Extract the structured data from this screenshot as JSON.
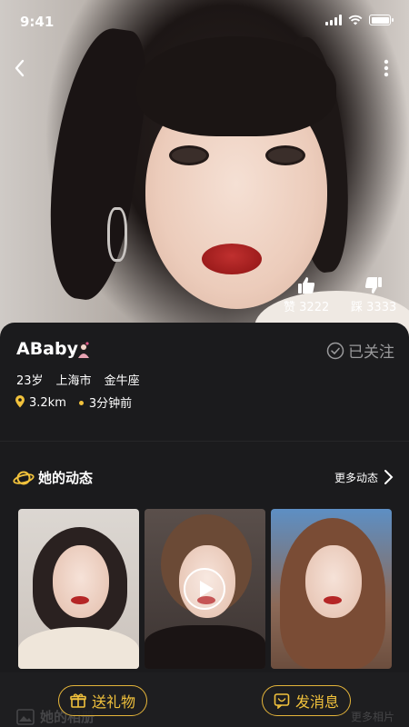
{
  "status_bar": {
    "time": "9:41"
  },
  "hero": {
    "like_label": "赞",
    "like_count": "3222",
    "dislike_label": "踩",
    "dislike_count": "3333"
  },
  "profile": {
    "name": "ABaby",
    "follow_label": "已关注",
    "age": "23岁",
    "city": "上海市",
    "zodiac": "金牛座",
    "distance": "3.2km",
    "last_active": "3分钟前"
  },
  "moments": {
    "title": "她的动态",
    "more_label": "更多动态",
    "thumbnails": [
      {
        "type": "photo"
      },
      {
        "type": "video"
      },
      {
        "type": "photo"
      }
    ]
  },
  "album_peek": {
    "title": "她的相册",
    "more_label": "更多相片"
  },
  "actions": {
    "gift_label": "送礼物",
    "message_label": "发消息"
  },
  "colors": {
    "accent": "#F2C23C",
    "background": "#1B1B1D",
    "follow_gray": "#9A9A9C"
  }
}
